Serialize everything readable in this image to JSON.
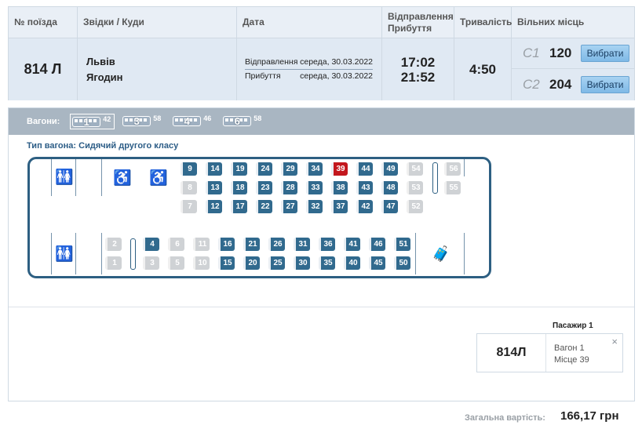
{
  "top_stub": "",
  "table": {
    "headers": {
      "train": "№ поїзда",
      "route": "Звідки / Куди",
      "date": "Дата",
      "dep_arr": "Відправлення Прибуття",
      "duration": "Тривалість",
      "free": "Вільних місць"
    },
    "row": {
      "train": "814 Л",
      "from": "Львів",
      "to": "Ягодин",
      "dep_label": "Відправлення",
      "dep_date": "середа, 30.03.2022",
      "arr_label": "Прибуття",
      "arr_date": "середа, 30.03.2022",
      "dep_time": "17:02",
      "arr_time": "21:52",
      "duration": "4:50",
      "classes": [
        {
          "cls": "С1",
          "count": "120",
          "button": "Вибрати"
        },
        {
          "cls": "С2",
          "count": "204",
          "button": "Вибрати"
        }
      ]
    }
  },
  "wagons": {
    "label": "Вагони:",
    "items": [
      {
        "num": "1",
        "free": "42"
      },
      {
        "num": "3",
        "free": "58"
      },
      {
        "num": "4",
        "free": "46"
      },
      {
        "num": "6",
        "free": "58"
      }
    ],
    "type_label": "Тип вагона: Сидячий другого класу"
  },
  "seats": {
    "upper": [
      {
        "n": "9",
        "s": "free"
      },
      {
        "n": "14",
        "s": "free"
      },
      {
        "n": "19",
        "s": "free"
      },
      {
        "n": "24",
        "s": "free"
      },
      {
        "n": "29",
        "s": "free"
      },
      {
        "n": "34",
        "s": "free"
      },
      {
        "n": "39",
        "s": "selected"
      },
      {
        "n": "44",
        "s": "free"
      },
      {
        "n": "49",
        "s": "free"
      },
      {
        "n": "54",
        "s": "busy"
      },
      {
        "n": "56",
        "s": "busy"
      },
      {
        "n": "8",
        "s": "busy"
      },
      {
        "n": "13",
        "s": "free"
      },
      {
        "n": "18",
        "s": "free"
      },
      {
        "n": "23",
        "s": "free"
      },
      {
        "n": "28",
        "s": "free"
      },
      {
        "n": "33",
        "s": "free"
      },
      {
        "n": "38",
        "s": "free"
      },
      {
        "n": "43",
        "s": "free"
      },
      {
        "n": "48",
        "s": "free"
      },
      {
        "n": "53",
        "s": "busy"
      },
      {
        "n": "55",
        "s": "busy"
      },
      {
        "n": "7",
        "s": "busy"
      },
      {
        "n": "12",
        "s": "free"
      },
      {
        "n": "17",
        "s": "free"
      },
      {
        "n": "22",
        "s": "free"
      },
      {
        "n": "27",
        "s": "free"
      },
      {
        "n": "32",
        "s": "free"
      },
      {
        "n": "37",
        "s": "free"
      },
      {
        "n": "42",
        "s": "free"
      },
      {
        "n": "47",
        "s": "free"
      },
      {
        "n": "52",
        "s": "busy"
      }
    ],
    "lower": [
      {
        "n": "2",
        "s": "busy"
      },
      {
        "n": "4",
        "s": "free"
      },
      {
        "n": "6",
        "s": "busy"
      },
      {
        "n": "11",
        "s": "busy"
      },
      {
        "n": "16",
        "s": "free"
      },
      {
        "n": "21",
        "s": "free"
      },
      {
        "n": "26",
        "s": "free"
      },
      {
        "n": "31",
        "s": "free"
      },
      {
        "n": "36",
        "s": "free"
      },
      {
        "n": "41",
        "s": "free"
      },
      {
        "n": "46",
        "s": "free"
      },
      {
        "n": "51",
        "s": "free"
      },
      {
        "n": "1",
        "s": "busy"
      },
      {
        "n": "3",
        "s": "busy"
      },
      {
        "n": "5",
        "s": "busy"
      },
      {
        "n": "10",
        "s": "busy"
      },
      {
        "n": "15",
        "s": "free"
      },
      {
        "n": "20",
        "s": "free"
      },
      {
        "n": "25",
        "s": "free"
      },
      {
        "n": "30",
        "s": "free"
      },
      {
        "n": "35",
        "s": "free"
      },
      {
        "n": "40",
        "s": "free"
      },
      {
        "n": "45",
        "s": "free"
      },
      {
        "n": "50",
        "s": "free"
      }
    ]
  },
  "passenger": {
    "heading": "Пасажир 1",
    "train": "814Л",
    "wagon": "Вагон 1",
    "seat": "Місце 39",
    "close": "×"
  },
  "total": {
    "label": "Загальна вартість:",
    "value": "166,17 грн"
  },
  "colors": {
    "seat_free": "#316a8e",
    "seat_selected": "#c3171d",
    "seat_busy": "#cfd2d5",
    "accent": "#2d5f82"
  }
}
